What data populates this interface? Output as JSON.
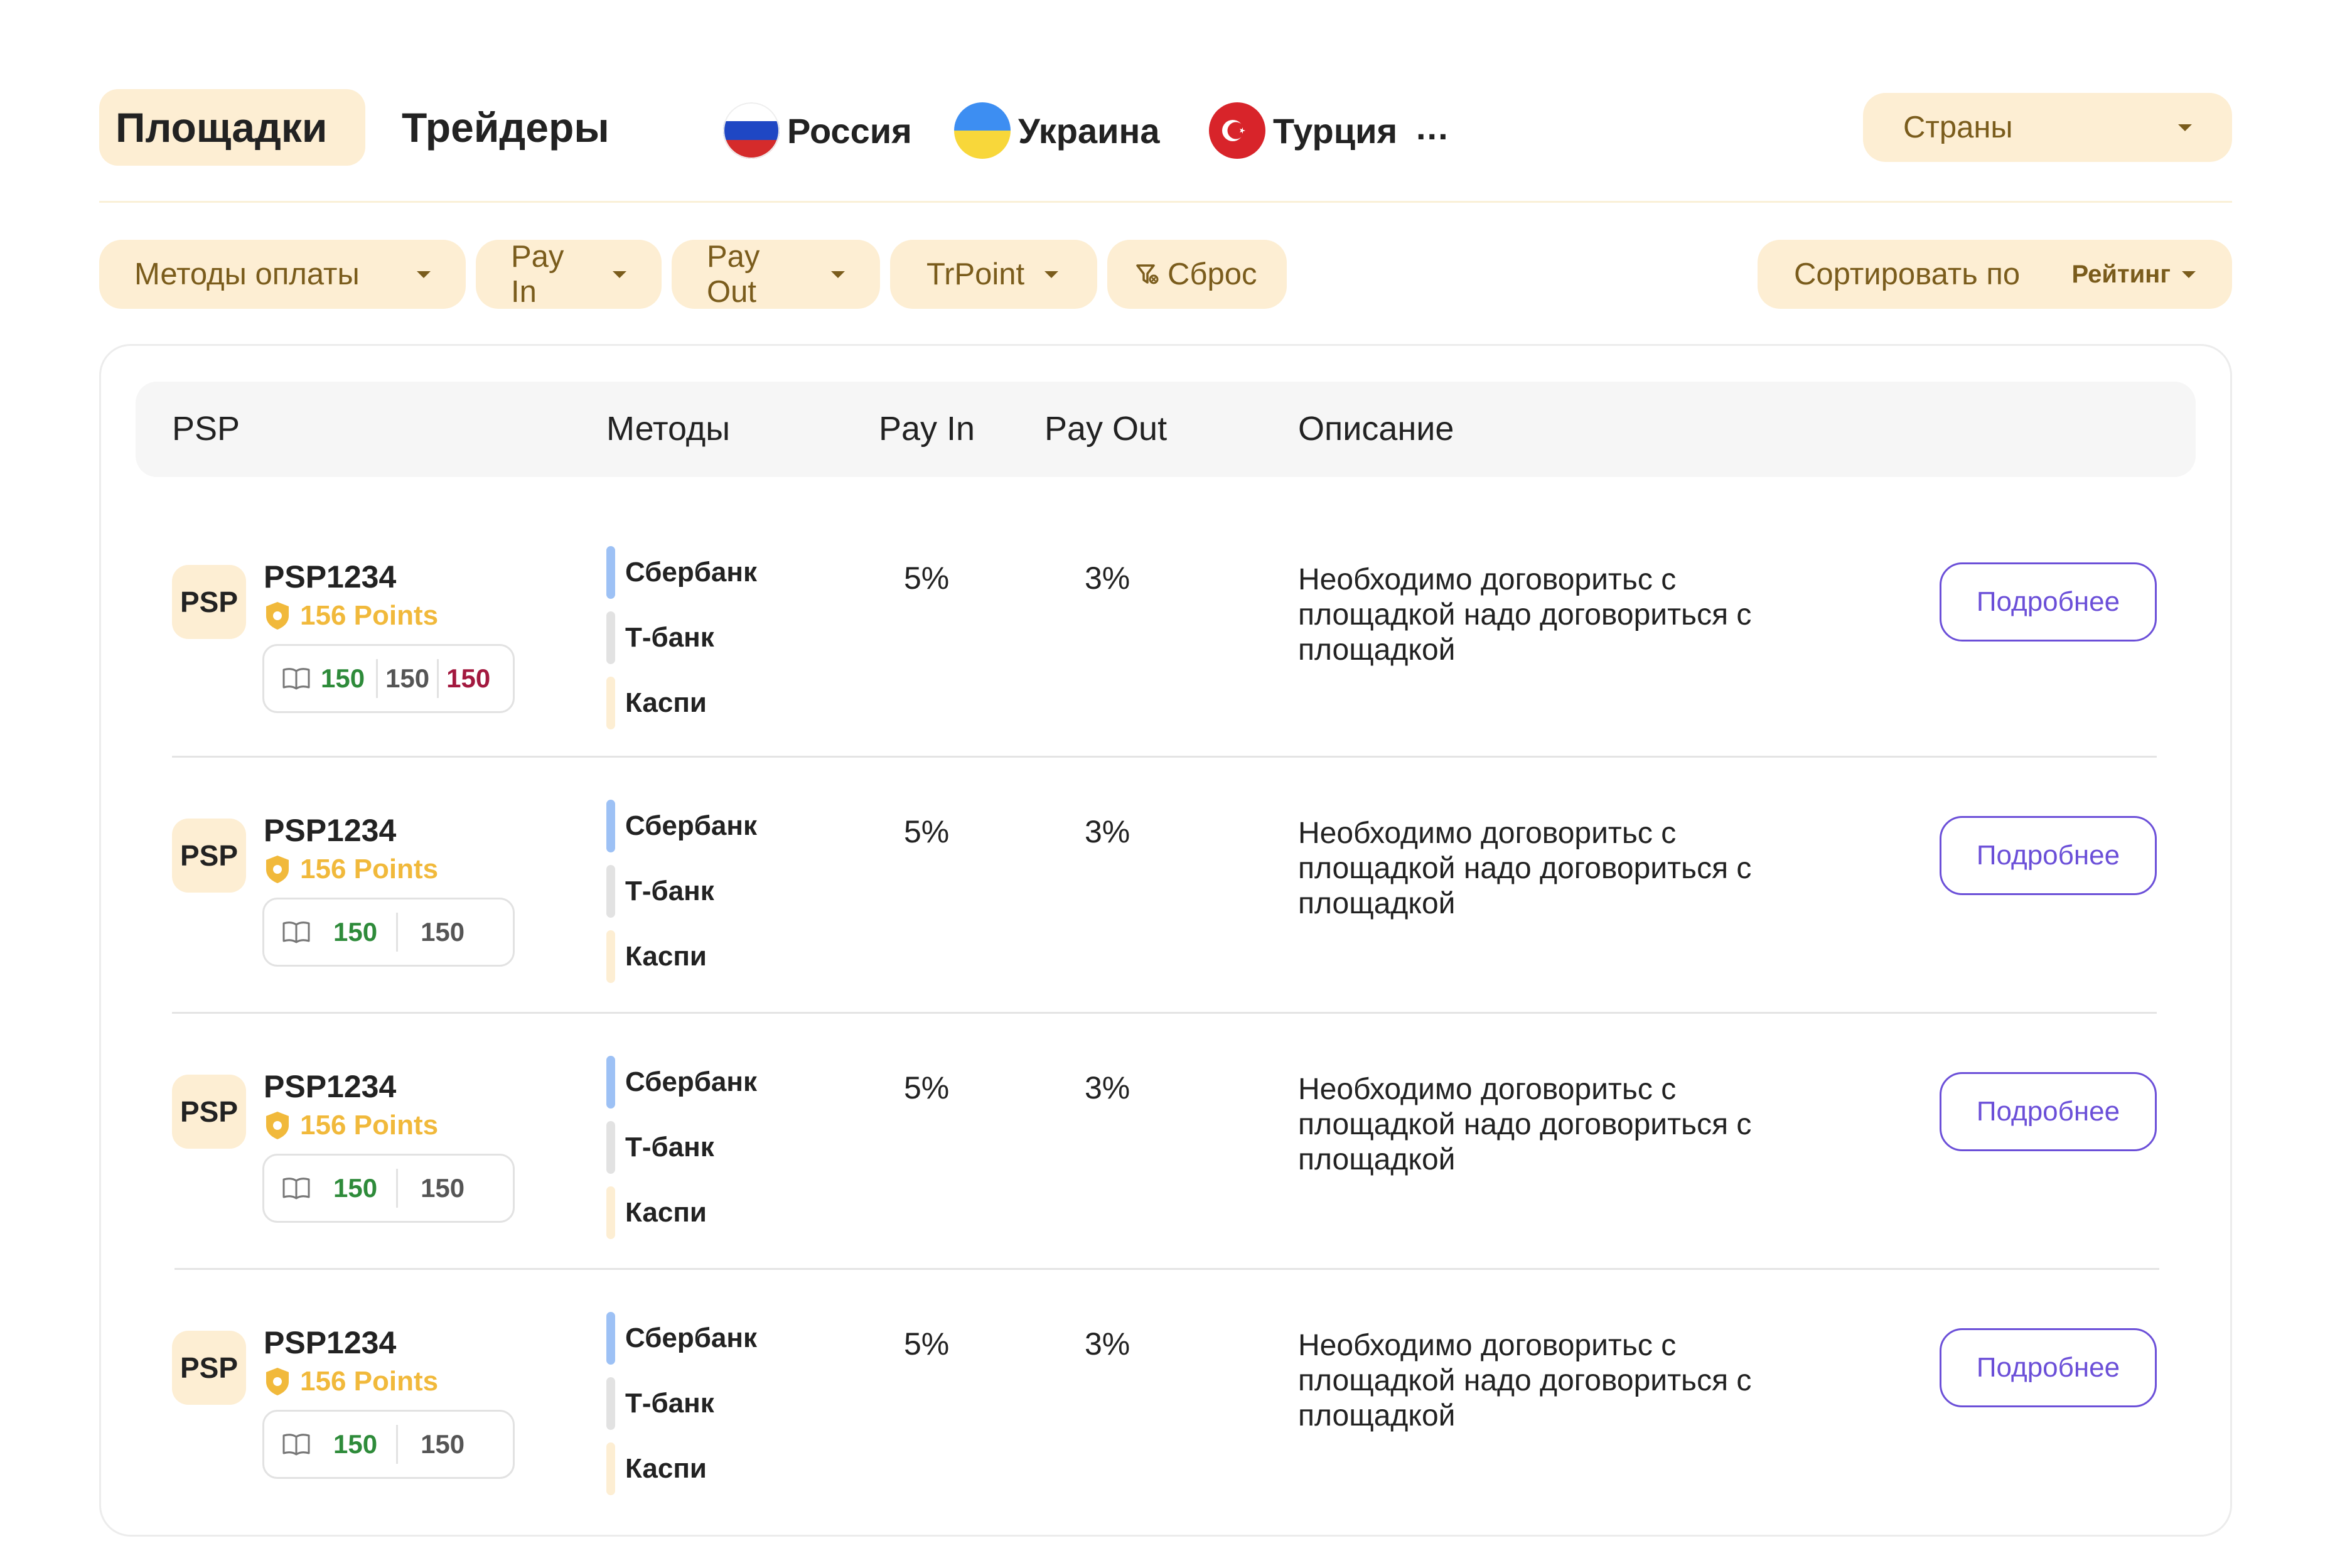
{
  "tabs": [
    {
      "label": "Площадки",
      "active": true
    },
    {
      "label": "Трейдеры",
      "active": false
    }
  ],
  "countries": [
    {
      "label": "Россия",
      "flag": "russia-flag-icon"
    },
    {
      "label": "Украина",
      "flag": "ukraine-flag-icon"
    },
    {
      "label": "Турция",
      "flag": "turkey-flag-icon"
    }
  ],
  "more_label": "...",
  "countries_select": {
    "label": "Страны"
  },
  "filters": {
    "methods": "Методы оплаты",
    "pay_in": "Pay In",
    "pay_out": "Pay Out",
    "trpoint": "TrPoint",
    "reset": "Сброс"
  },
  "sort": {
    "label": "Сортировать по",
    "value": "Рейтинг"
  },
  "table": {
    "headers": {
      "psp": "PSP",
      "methods": "Методы",
      "pay_in": "Pay In",
      "pay_out": "Pay Out",
      "description": "Описание"
    },
    "rows": [
      {
        "logo": "PSP",
        "name": "PSP1234",
        "points": "156 Points",
        "stats": [
          "150",
          "150",
          "150"
        ],
        "methods": [
          "Сбербанк",
          "Т-банк",
          "Каспи"
        ],
        "pay_in": "5%",
        "pay_out": "3%",
        "description": "Необходимо договоритьс с площадкой надо договориться с площадкой",
        "button": "Подробнее"
      },
      {
        "logo": "PSP",
        "name": "PSP1234",
        "points": "156 Points",
        "stats": [
          "150",
          "150"
        ],
        "methods": [
          "Сбербанк",
          "Т-банк",
          "Каспи"
        ],
        "pay_in": "5%",
        "pay_out": "3%",
        "description": "Необходимо договоритьс с площадкой надо договориться с площадкой",
        "button": "Подробнее"
      },
      {
        "logo": "PSP",
        "name": "PSP1234",
        "points": "156 Points",
        "stats": [
          "150",
          "150"
        ],
        "methods": [
          "Сбербанк",
          "Т-банк",
          "Каспи"
        ],
        "pay_in": "5%",
        "pay_out": "3%",
        "description": "Необходимо договоритьс с площадкой надо договориться с площадкой",
        "button": "Подробнее"
      },
      {
        "logo": "PSP",
        "name": "PSP1234",
        "points": "156 Points",
        "stats": [
          "150",
          "150"
        ],
        "methods": [
          "Сбербанк",
          "Т-банк",
          "Каспи"
        ],
        "pay_in": "5%",
        "pay_out": "3%",
        "description": "Необходимо договоритьс с площадкой надо договориться с площадкой",
        "button": "Подробнее"
      }
    ]
  },
  "colors": {
    "pill_bg": "#fdeed3",
    "pill_text": "#7a5c1c",
    "points": "#f1b93b",
    "stat_green": "#2e8b3a",
    "stat_gray": "#555555",
    "stat_red": "#a3193f",
    "button": "#6b4fd8",
    "method_bars": [
      "#9dc1f5",
      "#e2e2e2",
      "#fdeed3"
    ]
  }
}
